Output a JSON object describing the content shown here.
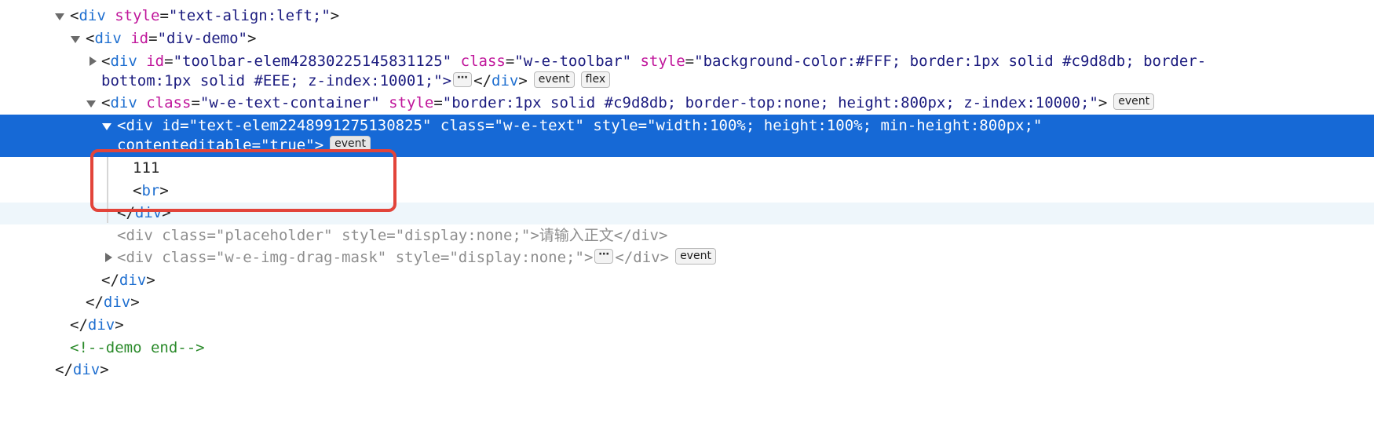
{
  "lines": {
    "l1": {
      "open": "<",
      "tag": "div",
      "attr1": "style",
      "eq": "=",
      "val1": "\"text-align:left;\"",
      "close": ">"
    },
    "l2": {
      "open": "<",
      "tag": "div",
      "attr1": "id",
      "eq": "=",
      "val1": "\"div-demo\"",
      "close": ">"
    },
    "l3a": {
      "open": "<",
      "tag": "div",
      "attr1": "id",
      "val1": "\"toolbar-elem42830225145831125\"",
      "attr2": "class",
      "val2": "\"w-e-toolbar\"",
      "attr3": "style",
      "val3": "\"background-color:#FFF; border:1px solid #c9d8db; border-"
    },
    "l3b": {
      "text": "bottom:1px solid #EEE; z-index:10001;\">",
      "endtag_open": "</",
      "tag": "div",
      "endtag_close": ">",
      "badge1": "event",
      "badge2": "flex"
    },
    "l4": {
      "open": "<",
      "tag": "div",
      "attr1": "class",
      "val1": "\"w-e-text-container\"",
      "attr2": "style",
      "val2": "\"border:1px solid #c9d8db; border-top:none; height:800px; z-index:10000;\"",
      "close": ">",
      "badge": "event"
    },
    "l5a": {
      "open": "<",
      "tag": "div",
      "attr1": "id",
      "val1": "\"text-elem2248991275130825\"",
      "attr2": "class",
      "val2": "\"w-e-text\"",
      "attr3": "style",
      "val3": "\"width:100%; height:100%; min-height:800px;\""
    },
    "l5b": {
      "attr": "contenteditable",
      "val": "\"true\"",
      "close": ">",
      "badge": "event"
    },
    "l6": {
      "text": "111"
    },
    "l7": {
      "open": "<",
      "tag": "br",
      "close": ">"
    },
    "l8": {
      "open": "</",
      "tag": "div",
      "close": ">"
    },
    "l9": {
      "open": "<",
      "tag": "div",
      "attr1": "class",
      "val1": "\"placeholder\"",
      "attr2": "style",
      "val2": "\"display:none;\"",
      "text": ">请输入正文",
      "endtag": "</div>"
    },
    "l10": {
      "open": "<",
      "tag": "div",
      "attr1": "class",
      "val1": "\"w-e-img-drag-mask\"",
      "attr2": "style",
      "val2": "\"display:none;\"",
      "close": ">",
      "endtag_open": "</",
      "endtag_close": ">",
      "badge": "event"
    },
    "l11": {
      "open": "</",
      "tag": "div",
      "close": ">"
    },
    "l12": {
      "open": "</",
      "tag": "div",
      "close": ">"
    },
    "l13": {
      "open": "</",
      "tag": "div",
      "close": ">"
    },
    "l14": {
      "text": "<!--demo end-->"
    },
    "l15": {
      "open": "</",
      "tag": "div",
      "close": ">"
    }
  },
  "ellipsis": "⋯",
  "icons": [
    "triangle-expanded-icon",
    "triangle-collapsed-icon"
  ],
  "colors": {
    "selection": "#1669d6",
    "highlight_box": "#e2443a",
    "tag_name": "#1f6fd0",
    "attr_name": "#c0169b",
    "attr_value": "#1b1b7f",
    "comment": "#2a8a2a"
  }
}
